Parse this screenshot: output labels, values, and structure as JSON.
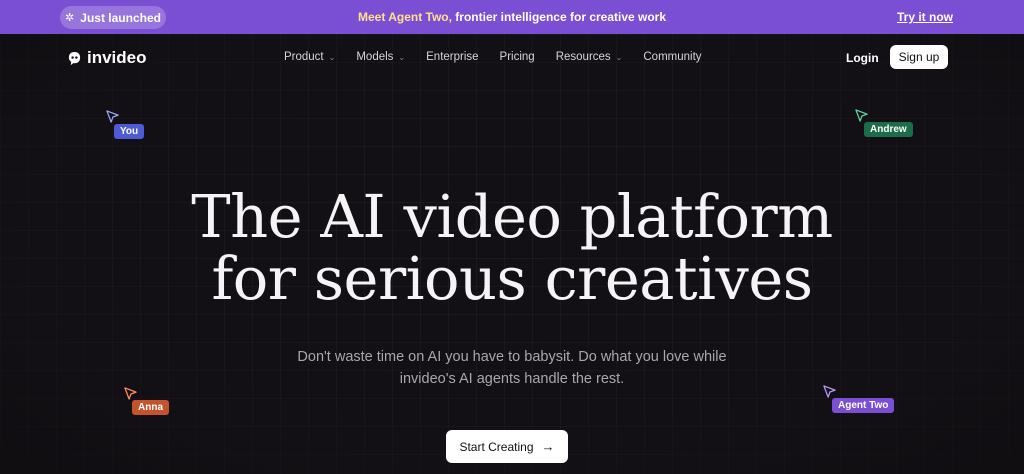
{
  "announcement": {
    "badge_label": "Just launched",
    "badge_icon": "sparkle-icon",
    "highlight": "Meet Agent Two,",
    "message": " frontier intelligence for creative work",
    "cta_label": "Try it now",
    "background_color": "#7b4fd3",
    "highlight_color": "#ffe08a"
  },
  "nav": {
    "logo_text": "invideo",
    "logo_icon": "invideo-logo-icon",
    "items": [
      {
        "label": "Product",
        "has_dropdown": true
      },
      {
        "label": "Models",
        "has_dropdown": true
      },
      {
        "label": "Enterprise",
        "has_dropdown": false
      },
      {
        "label": "Pricing",
        "has_dropdown": false
      },
      {
        "label": "Resources",
        "has_dropdown": true
      },
      {
        "label": "Community",
        "has_dropdown": false
      }
    ],
    "login_label": "Login",
    "signup_label": "Sign up"
  },
  "cursors": [
    {
      "label": "You",
      "color": "#4f5bd5"
    },
    {
      "label": "Andrew",
      "color": "#1c6b4a"
    },
    {
      "label": "Anna",
      "color": "#c4532d"
    },
    {
      "label": "Agent Two",
      "color": "#7b4fd3"
    }
  ],
  "hero": {
    "headline_line1": "The AI video platform",
    "headline_line2": "for serious creatives",
    "subtitle_line1": "Don't waste time on AI you have to babysit. Do what you love while",
    "subtitle_line2": "invideo's AI agents handle the rest.",
    "cta_label": "Start Creating"
  }
}
